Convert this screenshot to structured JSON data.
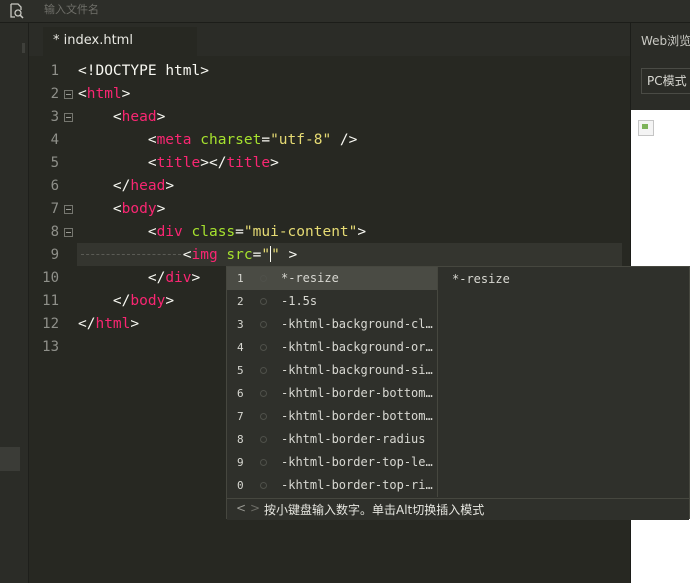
{
  "search": {
    "placeholder": "输入文件名",
    "icon": "file-search-icon"
  },
  "tab": {
    "label": "* index.html"
  },
  "editor": {
    "line_numbers": [
      "1",
      "2",
      "3",
      "4",
      "5",
      "6",
      "7",
      "8",
      "9",
      "10",
      "11",
      "12",
      "13"
    ]
  },
  "code": {
    "l1": {
      "open": "<!DOCTYPE ",
      "name": "html",
      "close": ">"
    },
    "l2": {
      "lt": "<",
      "tag": "html",
      "gt": ">"
    },
    "l3": {
      "indent": "    ",
      "lt": "<",
      "tag": "head",
      "gt": ">"
    },
    "l4": {
      "indent": "        ",
      "lt": "<",
      "tag": "meta",
      "attr": " charset",
      "eq": "=",
      "val": "\"utf-8\"",
      "end": " />"
    },
    "l5": {
      "indent": "        ",
      "lt": "<",
      "tag": "title",
      "mid": "></",
      "tag2": "title",
      "gt": ">"
    },
    "l6": {
      "indent": "    ",
      "lt": "</",
      "tag": "head",
      "gt": ">"
    },
    "l7": {
      "indent": "    ",
      "lt": "<",
      "tag": "body",
      "gt": ">"
    },
    "l8": {
      "indent": "        ",
      "lt": "<",
      "tag": "div",
      "attr": " class",
      "eq": "=",
      "val": "\"mui-content\"",
      "gt": ">"
    },
    "l9": {
      "indent": "            ",
      "lt": "<",
      "tag": "img",
      "attr": " src",
      "eq": "=",
      "q1": "\"",
      "q2": "\"",
      "end": " >"
    },
    "l10": {
      "indent": "        ",
      "lt": "</",
      "tag": "div",
      "gt": ">"
    },
    "l11": {
      "indent": "    ",
      "lt": "</",
      "tag": "body",
      "gt": ">"
    },
    "l12": {
      "lt": "</",
      "tag": "html",
      "gt": ">"
    }
  },
  "right_panel": {
    "title": "Web浏览",
    "mode": "PC模式"
  },
  "autocomplete": {
    "items": [
      {
        "num": "1",
        "label": "*-resize"
      },
      {
        "num": "2",
        "label": "-1.5s"
      },
      {
        "num": "3",
        "label": "-khtml-background-cl…"
      },
      {
        "num": "4",
        "label": "-khtml-background-or…"
      },
      {
        "num": "5",
        "label": "-khtml-background-si…"
      },
      {
        "num": "6",
        "label": "-khtml-border-bottom…"
      },
      {
        "num": "7",
        "label": "-khtml-border-bottom…"
      },
      {
        "num": "8",
        "label": "-khtml-border-radius"
      },
      {
        "num": "9",
        "label": "-khtml-border-top-le…"
      },
      {
        "num": "0",
        "label": "-khtml-border-top-ri…"
      }
    ],
    "selected_index": 0,
    "detail": "*-resize",
    "nav_prev": "<",
    "nav_next": ">",
    "hint": "按小键盘输入数字。单击Alt切换插入模式"
  },
  "colors": {
    "background": "#272822",
    "tag": "#f92672",
    "attribute": "#a6e22e",
    "string": "#e6db74",
    "text": "#f8f8f2"
  }
}
